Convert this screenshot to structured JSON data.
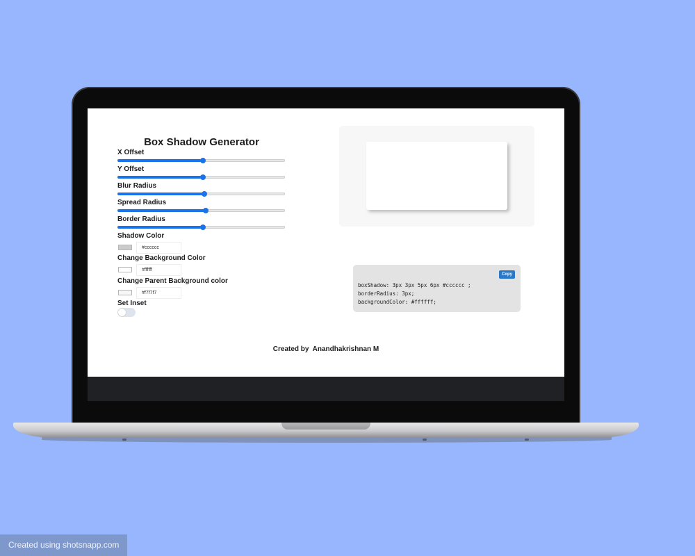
{
  "app": {
    "title": "Box Shadow Generator",
    "controls": [
      {
        "label": "X Offset",
        "value": 0.51
      },
      {
        "label": "Y Offset",
        "value": 0.51
      },
      {
        "label": "Blur Radius",
        "value": 0.52
      },
      {
        "label": "Spread Radius",
        "value": 0.525
      },
      {
        "label": "Border Radius",
        "value": 0.51
      }
    ],
    "shadow_color": {
      "label": "Shadow Color",
      "hex": "#cccccc",
      "swatch": "#cccccc"
    },
    "bg_color": {
      "label": "Change Background Color",
      "hex": "#ffffff",
      "swatch": "#ffffff"
    },
    "parent_bg_color": {
      "label": "Change Parent Background color",
      "hex": "#f7f7f7",
      "swatch": "#f7f7f7"
    },
    "inset": {
      "label": "Set Inset",
      "checked": false
    },
    "code": {
      "copy_label": "Copy",
      "lines": [
        "boxShadow: 3px 3px 5px 6px #cccccc ;",
        "borderRadius: 3px;",
        "backgroundColor: #ffffff;"
      ]
    },
    "credit": "Created by  Anandhakrishnan M"
  },
  "watermark": "Created using shotsnapp.com",
  "colors": {
    "page_bg": "#97b6fe",
    "accent": "#1a73e8",
    "copy_button": "#2a78c9"
  }
}
